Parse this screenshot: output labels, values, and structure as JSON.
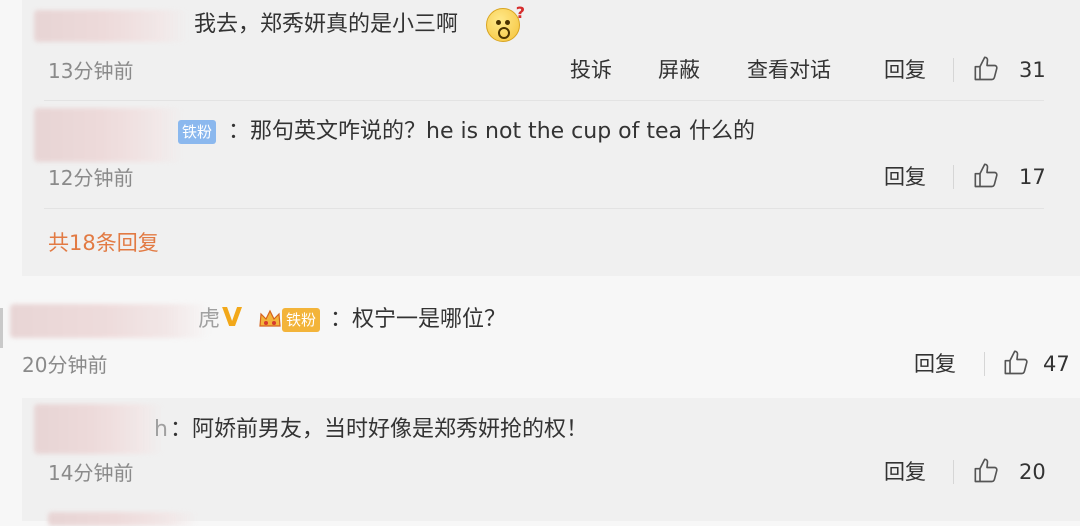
{
  "thread1": {
    "reply1": {
      "text": "我去，郑秀妍真的是小三啊",
      "time": "13分钟前",
      "actions": {
        "report": "投诉",
        "block": "屏蔽",
        "view_conversation": "查看对话",
        "reply": "回复"
      },
      "likes": "31"
    },
    "reply2": {
      "badge": "铁粉",
      "text": "：那句英文咋说的？he is not the cup of tea 什么的",
      "time": "12分钟前",
      "reply": "回复",
      "likes": "17"
    },
    "more_replies": "共18条回复"
  },
  "comment2": {
    "name_tail": "虎",
    "badge": "铁粉",
    "text": "：权宁一是哪位？",
    "time": "20分钟前",
    "reply": "回复",
    "likes": "47"
  },
  "thread2": {
    "reply1": {
      "name_tail": "h",
      "text": "：阿娇前男友，当时好像是郑秀妍抢的权！",
      "time": "14分钟前",
      "reply": "回复",
      "likes": "20"
    }
  },
  "colors": {
    "more_link": "#e27a43",
    "badge_blue": "#8bb8ee",
    "badge_gold": "#f3b43a",
    "verified_v": "#f2a81a"
  },
  "icons": [
    "thumbs-up-icon",
    "confused-emoji-icon",
    "verified-v-icon",
    "crown-icon"
  ]
}
